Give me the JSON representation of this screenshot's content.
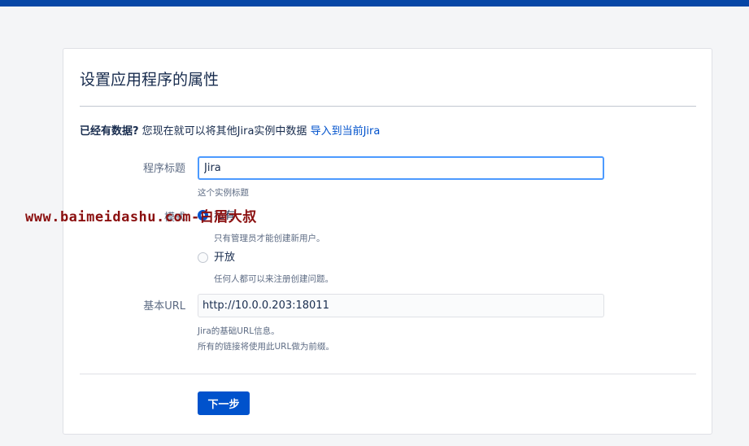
{
  "header": {
    "accent_color": "#0747a6"
  },
  "page": {
    "title": "设置应用程序的属性",
    "existing_data": {
      "bold": "已经有数据?",
      "text": " 您现在就可以将其他Jira实例中数据 ",
      "link": "导入到当前Jira"
    }
  },
  "form": {
    "app_title": {
      "label": "程序标题",
      "value": "Jira",
      "help": "这个实例标题"
    },
    "mode": {
      "label": "模式",
      "options": [
        {
          "label": "私有",
          "help": "只有管理员才能创建新用户。",
          "checked": true
        },
        {
          "label": "开放",
          "help": "任何人都可以来注册创建问题。",
          "checked": false
        }
      ]
    },
    "base_url": {
      "label": "基本URL",
      "value": "http://10.0.0.203:18011",
      "help_line1": "Jira的基础URL信息。",
      "help_line2": "所有的链接将使用此URL做为前缀。"
    },
    "next_label": "下一步"
  },
  "watermark": "www.baimeidashu.com-白眉大叔",
  "colors": {
    "primary": "#0052cc",
    "focus": "#4c9aff",
    "background": "#f4f5f7",
    "watermark": "#8b1010"
  }
}
